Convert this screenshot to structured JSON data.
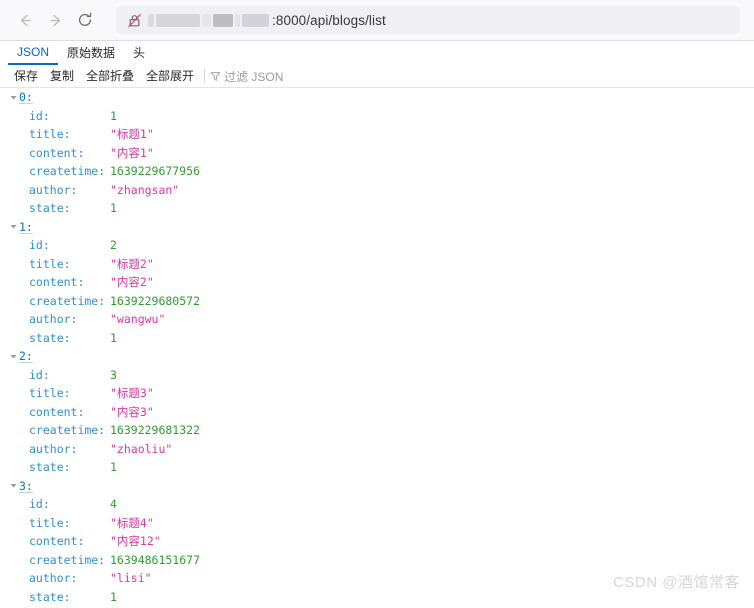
{
  "browser": {
    "back_icon": "arrow-left-icon",
    "forward_icon": "arrow-right-icon",
    "reload_icon": "reload-icon",
    "security_icon": "lock-crossed-out-icon",
    "url_text": ":8000/api/blogs/list",
    "url_host_redacted": true
  },
  "viewer": {
    "tabs": [
      {
        "label": "JSON",
        "active": true
      },
      {
        "label": "原始数据",
        "active": false
      },
      {
        "label": "头",
        "active": false
      }
    ],
    "toolbar": {
      "save_label": "保存",
      "copy_label": "复制",
      "collapse_all_label": "全部折叠",
      "expand_all_label": "全部展开",
      "filter_icon": "funnel-icon",
      "filter_placeholder": "过滤 JSON"
    }
  },
  "json": {
    "keys": {
      "id": "id:",
      "title": "title:",
      "content": "content:",
      "createtime": "createtime:",
      "author": "author:",
      "state": "state:"
    },
    "nodes": [
      {
        "index_label": "0:",
        "id": "1",
        "title": "\"标题1\"",
        "content": "\"内容1\"",
        "createtime": "1639229677956",
        "author": "\"zhangsan\"",
        "state": "1"
      },
      {
        "index_label": "1:",
        "id": "2",
        "title": "\"标题2\"",
        "content": "\"内容2\"",
        "createtime": "1639229680572",
        "author": "\"wangwu\"",
        "state": "1"
      },
      {
        "index_label": "2:",
        "id": "3",
        "title": "\"标题3\"",
        "content": "\"内容3\"",
        "createtime": "1639229681322",
        "author": "\"zhaoliu\"",
        "state": "1"
      },
      {
        "index_label": "3:",
        "id": "4",
        "title": "\"标题4\"",
        "content": "\"内容12\"",
        "createtime": "1639486151677",
        "author": "\"lisi\"",
        "state": "1"
      }
    ]
  },
  "watermark": {
    "text": "CSDN @酒馆常客"
  },
  "colors": {
    "accent": "#0a66c2",
    "key": "#2f8fd8",
    "number": "#2f9e2f",
    "string": "#e0369e",
    "node": "#0b72c4"
  }
}
